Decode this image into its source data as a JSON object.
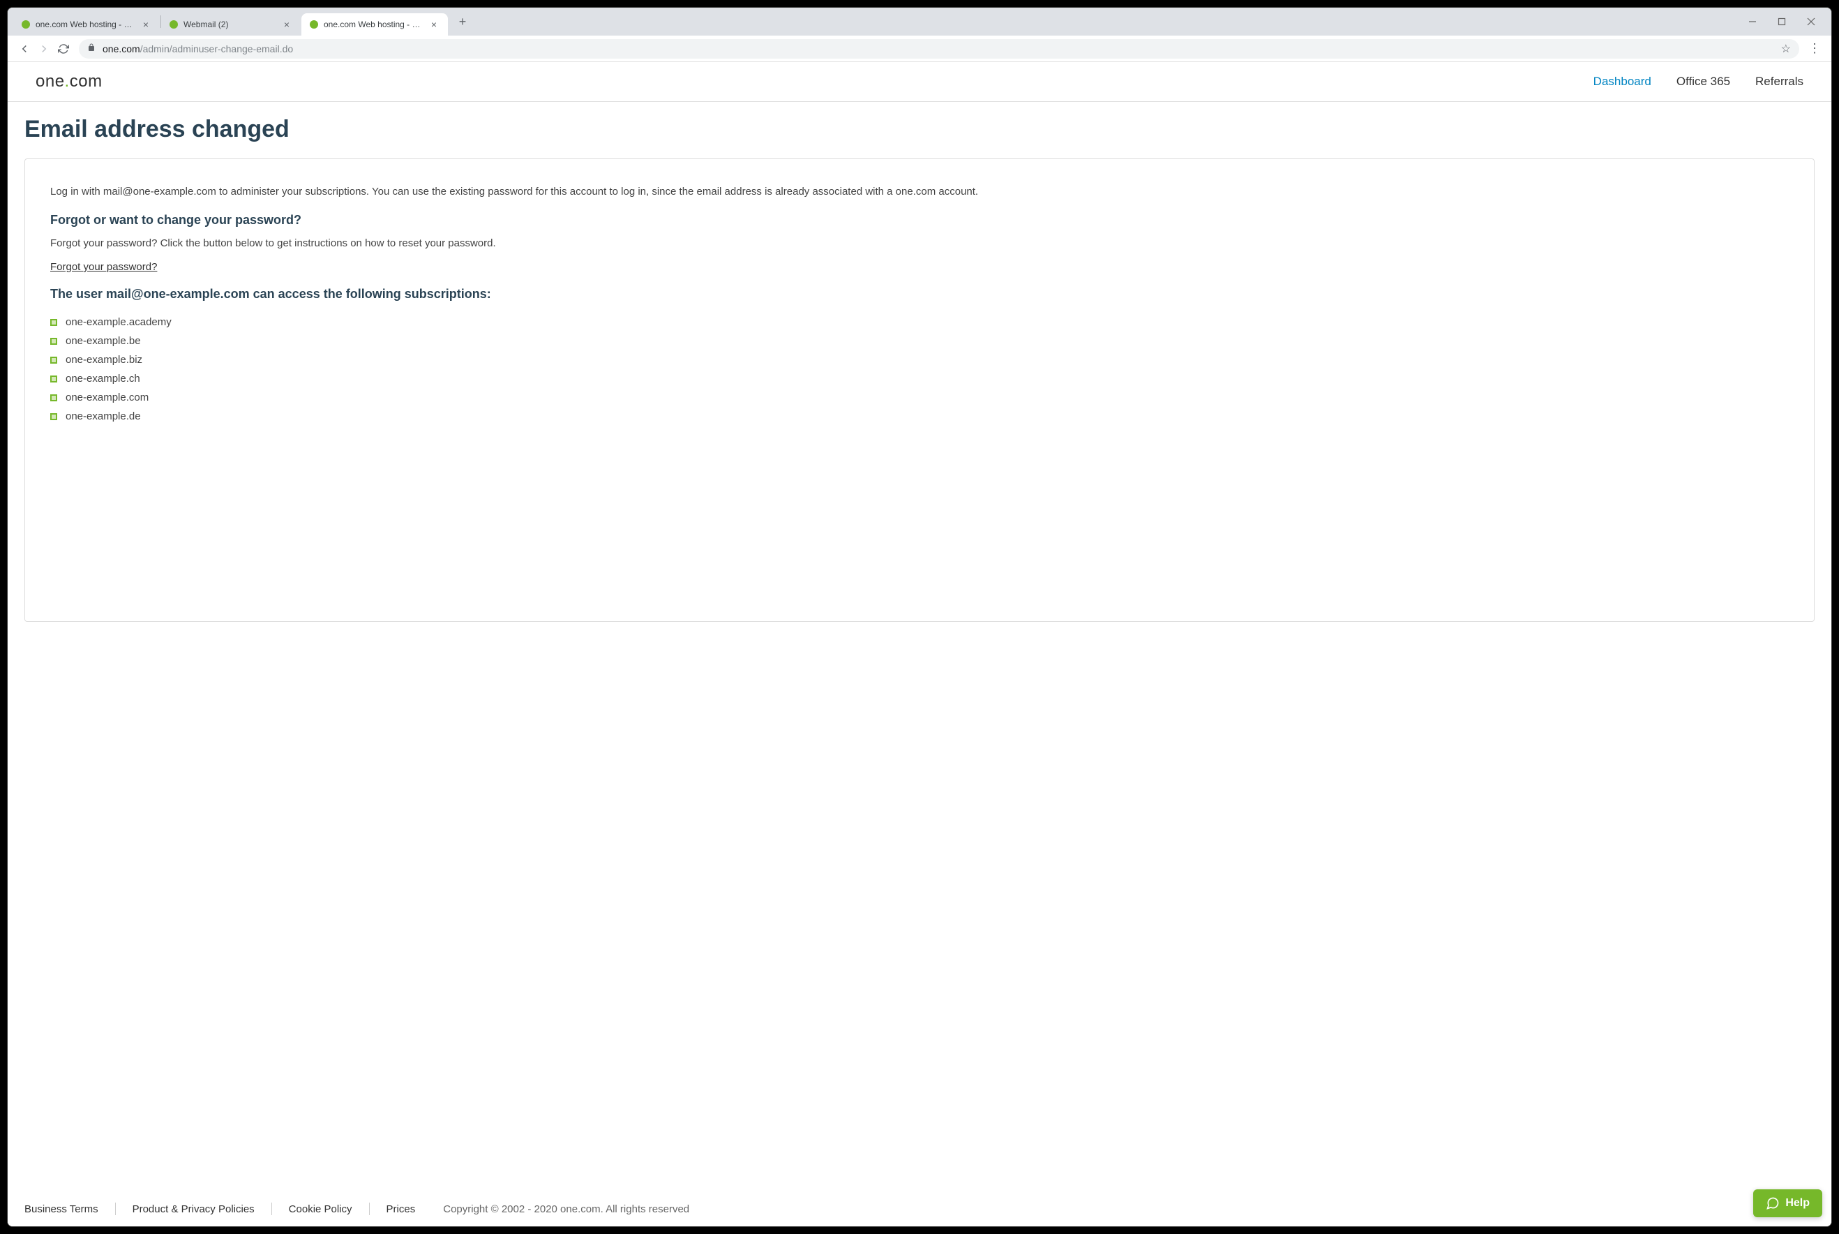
{
  "browser": {
    "tabs": [
      {
        "title": "one.com Web hosting  -  Domain",
        "active": false
      },
      {
        "title": "Webmail (2)",
        "active": false
      },
      {
        "title": "one.com Web hosting  -  Domain",
        "active": true
      }
    ],
    "url_host": "one.com",
    "url_path": "/admin/adminuser-change-email.do"
  },
  "header": {
    "logo_prefix": "one",
    "logo_dot": ".",
    "logo_suffix": "com",
    "nav": {
      "dashboard": "Dashboard",
      "office365": "Office 365",
      "referrals": "Referrals"
    }
  },
  "main": {
    "title": "Email address changed",
    "intro": "Log in with mail@one-example.com to administer your subscriptions. You can use the existing password for this account to log in, since the email address is already associated with a one.com account.",
    "forgot_heading": "Forgot or want to change your password?",
    "forgot_text": "Forgot your password? Click the button below to get instructions on how to reset your password.",
    "forgot_link": "Forgot your password?",
    "subs_heading": "The user mail@one-example.com can access the following subscriptions:",
    "subscriptions": [
      "one-example.academy",
      "one-example.be",
      "one-example.biz",
      "one-example.ch",
      "one-example.com",
      "one-example.de"
    ]
  },
  "footer": {
    "business_terms": "Business Terms",
    "privacy": "Product & Privacy Policies",
    "cookie": "Cookie Policy",
    "prices": "Prices",
    "copyright": "Copyright © 2002 - 2020 one.com. All rights reserved"
  },
  "help": {
    "label": "Help"
  }
}
